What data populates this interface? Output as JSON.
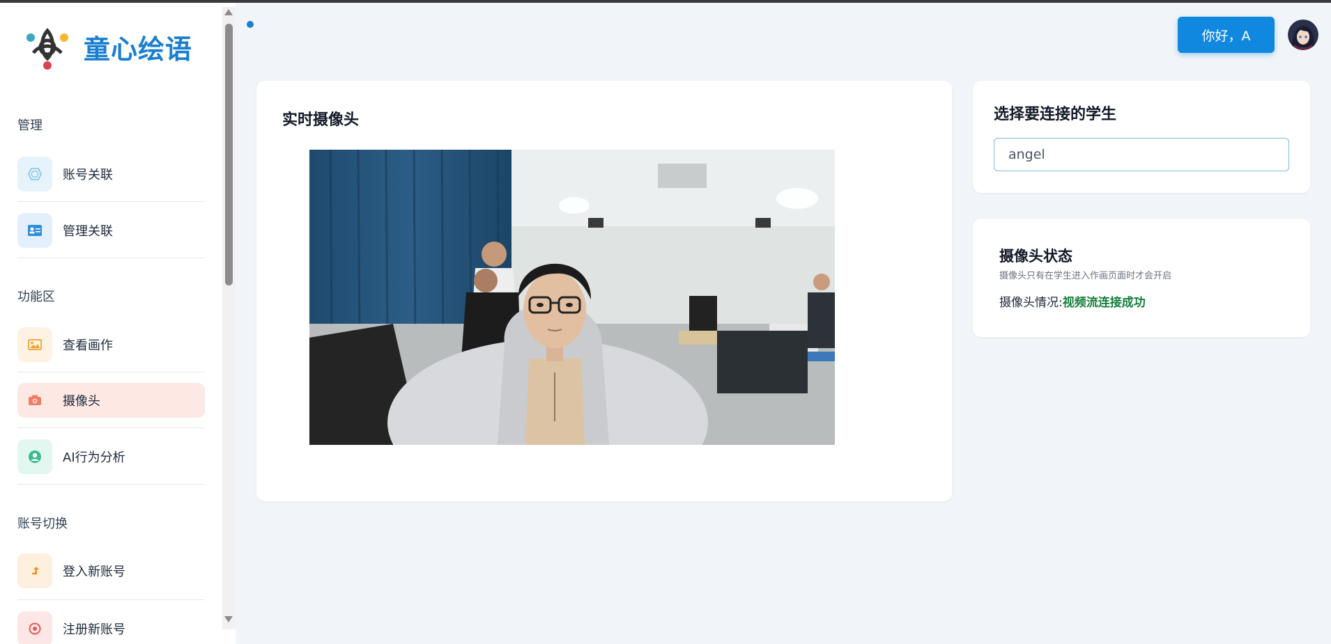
{
  "brand": {
    "name": "童心绘语",
    "colors": [
      "#3aa8c1",
      "#f5b731",
      "#d9424f",
      "#333333"
    ]
  },
  "sidebar": {
    "sections": [
      {
        "title": "管理"
      },
      {
        "title": "功能区"
      },
      {
        "title": "账号切换"
      }
    ],
    "items": [
      {
        "label": "账号关联",
        "icon": "hexagon-icon",
        "color": "#7cc2ea"
      },
      {
        "label": "管理关联",
        "icon": "id-card-icon",
        "color": "#2f8fd8"
      },
      {
        "label": "查看画作",
        "icon": "image-icon",
        "color": "#f0a030"
      },
      {
        "label": "摄像头",
        "icon": "camera-icon",
        "color": "#f07d67",
        "active": true
      },
      {
        "label": "AI行为分析",
        "icon": "user-circle-icon",
        "color": "#3dbb8f"
      },
      {
        "label": "登入新账号",
        "icon": "arrow-up-icon",
        "color": "#e8921e"
      },
      {
        "label": "注册新账号",
        "icon": "circle-icon",
        "color": "#e85858"
      }
    ]
  },
  "header": {
    "greeting": "你好，A"
  },
  "camera_panel": {
    "title": "实时摄像头"
  },
  "student_select": {
    "title": "选择要连接的学生",
    "value": "angel"
  },
  "camera_status": {
    "title": "摄像头状态",
    "hint": "摄像头只有在学生进入作画页面时才会开启",
    "label": "摄像头情况:",
    "value": "视频流连接成功"
  },
  "colors": {
    "accent": "#1188e0",
    "success": "#15803d",
    "active_bg": "#fde8e4"
  }
}
